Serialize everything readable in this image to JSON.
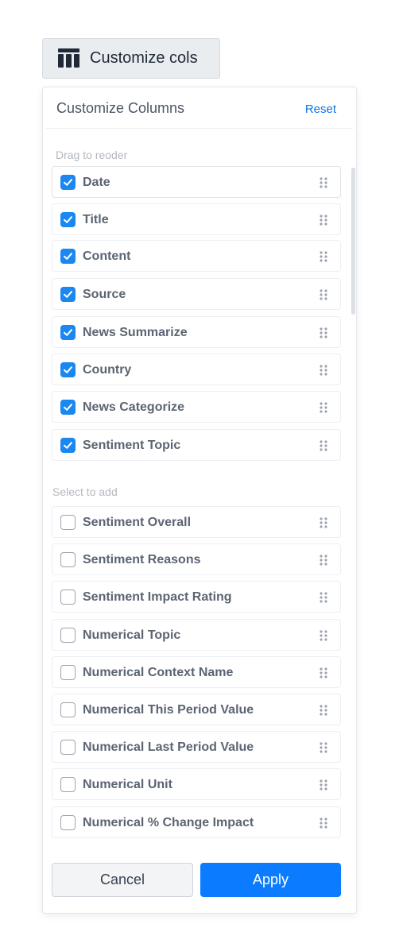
{
  "toggle": {
    "label": "Customize cols",
    "icon": "table-columns-icon"
  },
  "panel": {
    "title": "Customize Columns",
    "reset_label": "Reset",
    "selected_section_label": "Drag to reoder",
    "available_section_label": "Select to add",
    "selected_columns": [
      {
        "label": "Date",
        "checked": true
      },
      {
        "label": "Title",
        "checked": true
      },
      {
        "label": "Content",
        "checked": true
      },
      {
        "label": "Source",
        "checked": true
      },
      {
        "label": "News Summarize",
        "checked": true
      },
      {
        "label": "Country",
        "checked": true
      },
      {
        "label": "News Categorize",
        "checked": true
      },
      {
        "label": "Sentiment Topic",
        "checked": true
      }
    ],
    "available_columns": [
      {
        "label": "Sentiment Overall",
        "checked": false
      },
      {
        "label": "Sentiment Reasons",
        "checked": false
      },
      {
        "label": "Sentiment Impact Rating",
        "checked": false
      },
      {
        "label": "Numerical Topic",
        "checked": false
      },
      {
        "label": "Numerical Context Name",
        "checked": false
      },
      {
        "label": "Numerical This Period Value",
        "checked": false
      },
      {
        "label": "Numerical Last Period Value",
        "checked": false
      },
      {
        "label": "Numerical Unit",
        "checked": false
      },
      {
        "label": "Numerical % Change Impact",
        "checked": false
      }
    ],
    "cancel_label": "Cancel",
    "apply_label": "Apply"
  },
  "colors": {
    "accent": "#1a88f0",
    "apply_button": "#0b7cff",
    "reset_link": "#0b74e5"
  }
}
